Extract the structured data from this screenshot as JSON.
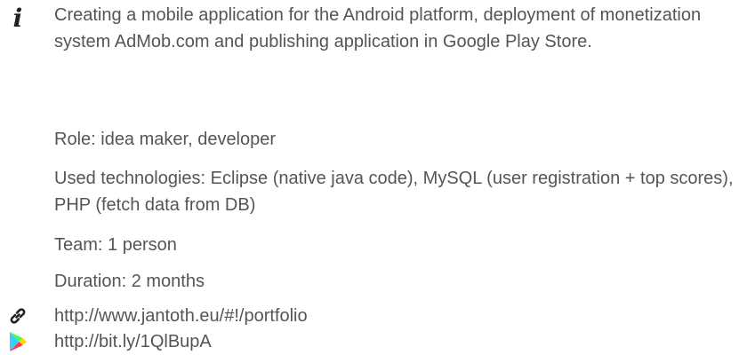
{
  "project": {
    "description": "Creating a mobile application for the Android platform, deployment of monetization system AdMob.com and publishing application in Google Play Store.",
    "role": "Role: idea maker, developer",
    "technologies": "Used technologies: Eclipse (native java code), MySQL (user registration + top scores), PHP (fetch data from DB)",
    "team": "Team: 1 person",
    "duration": "Duration: 2 months"
  },
  "links": {
    "portfolio_url": "http://www.jantoth.eu/#!/portfolio",
    "store_url": "http://bit.ly/1QlBupA"
  },
  "icons": {
    "info": "info-icon",
    "link": "link-icon",
    "store": "google-play-icon"
  },
  "colors": {
    "text": "#555555",
    "icon_dark": "#222222",
    "play_blue": "#3BCCFF",
    "play_green": "#48FF48",
    "play_red": "#FF3A44",
    "play_yellow": "#FFD400"
  }
}
